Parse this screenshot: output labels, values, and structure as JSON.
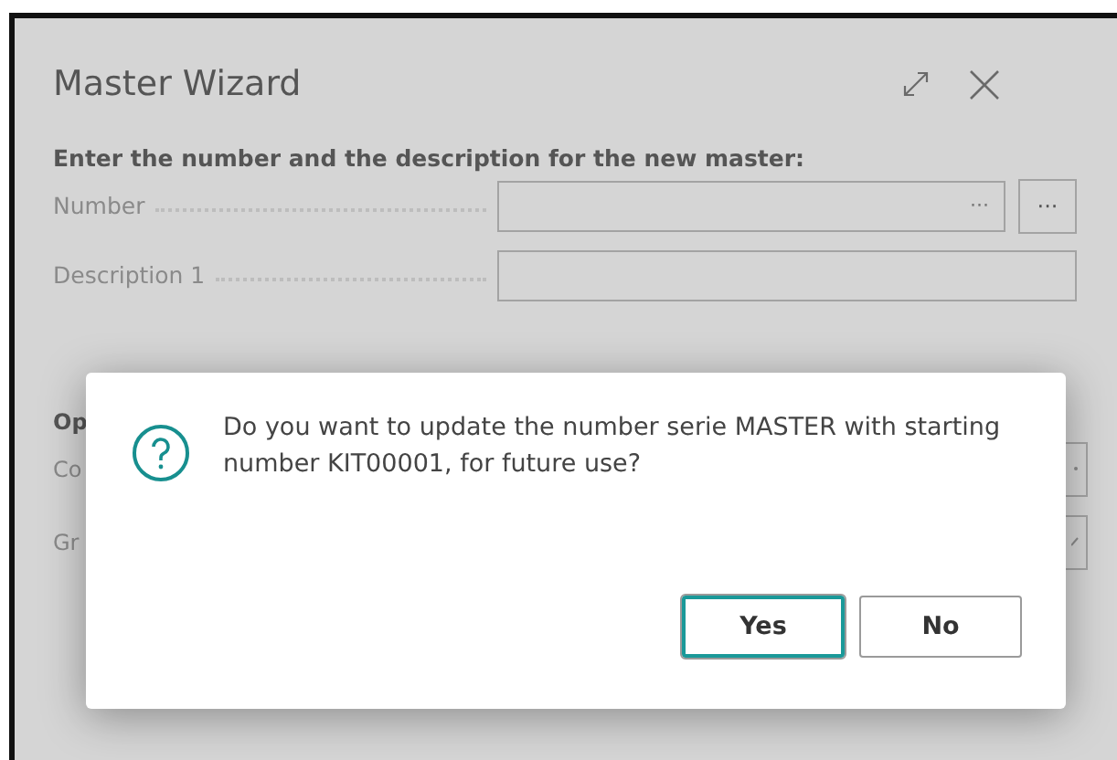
{
  "window": {
    "title": "Master Wizard"
  },
  "general": {
    "heading": "Enter the number and the description for the new master:",
    "fields": [
      {
        "label": "Number",
        "kind": "lookup",
        "glyph": "···",
        "button": "···"
      },
      {
        "label": "Description 1",
        "kind": "text"
      }
    ]
  },
  "options": {
    "heading": "Op",
    "fields": [
      {
        "label": "Co",
        "kind": "lookup"
      },
      {
        "label": "Gr",
        "kind": "dropdown"
      }
    ]
  },
  "dialog": {
    "message": "Do you want to update the number serie MASTER with starting number KIT00001, for future use?",
    "buttons": [
      {
        "label": "Yes",
        "selected": true
      },
      {
        "label": "No",
        "selected": false
      }
    ]
  }
}
